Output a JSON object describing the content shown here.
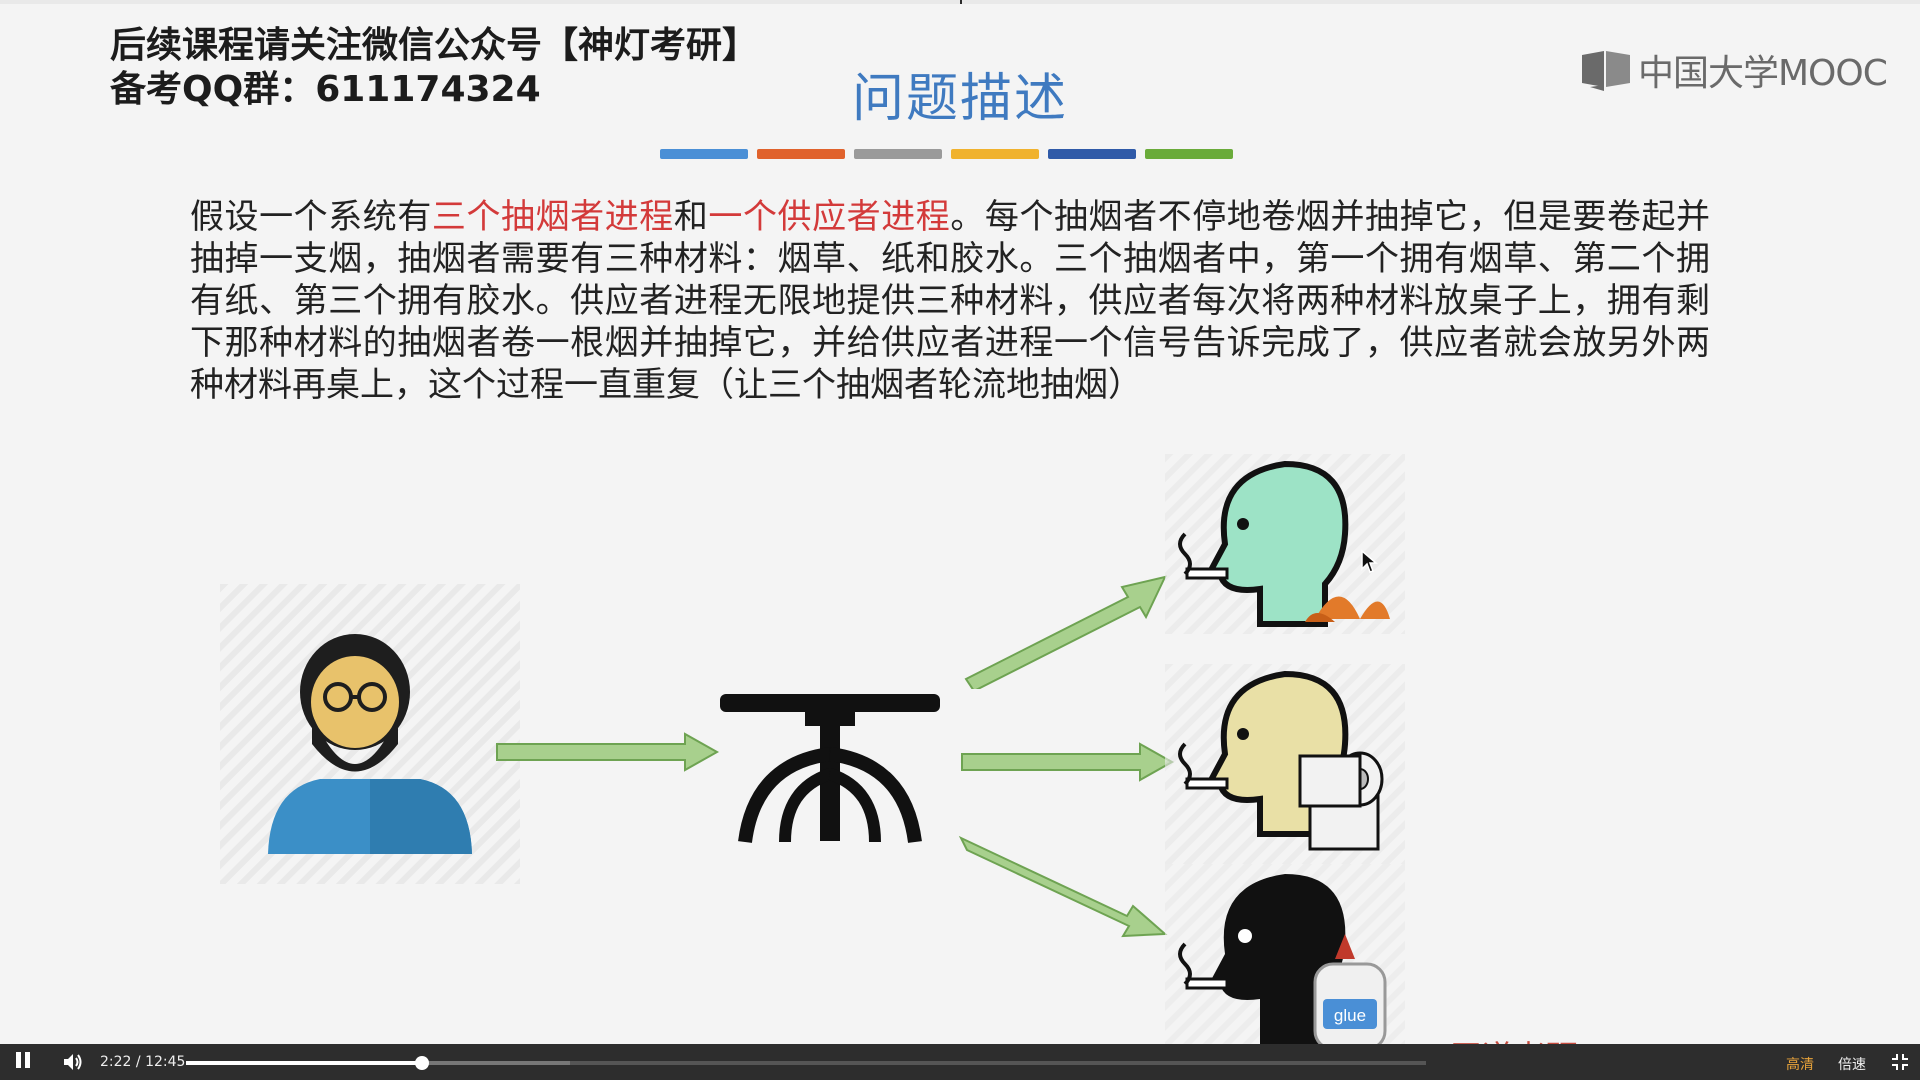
{
  "header": {
    "promo_line1": "后续课程请关注微信公众号【神灯考研】",
    "promo_line2": "备考QQ群：611174324",
    "title": "问题描述",
    "logo_text": "中国大学MOOC",
    "color_bars": [
      "#4a8fd6",
      "#e0622c",
      "#9a9a9a",
      "#f0b22e",
      "#2f5aa8",
      "#6aab3a"
    ]
  },
  "paragraph": {
    "part1": "假设一个系统有",
    "hl1": "三个抽烟者进程",
    "part2": "和",
    "hl2": "一个供应者进程",
    "part3": "。每个抽烟者不停地卷烟并抽掉它，但是要卷起并抽掉一支烟，抽烟者需要有三种材料：烟草、纸和胶水。三个抽烟者中，第一个拥有烟草、第二个拥有纸、第三个拥有胶水。供应者进程无限地提供三种材料，供应者每次将两种材料放桌子上，拥有剩下那种材料的抽烟者卷一根烟并抽掉它，并给供应者进程一个信号告诉完成了，供应者就会放另外两种材料再桌上，这个过程一直重复（让三个抽烟者轮流地抽烟）"
  },
  "diagram": {
    "glue_label": "glue",
    "colors": {
      "arrow": "#a8d08d",
      "arrow_stroke": "#6ea352",
      "smoker1": "#9de3c6",
      "smoker2": "#e9e0a6",
      "smoker3": "#111111",
      "tobacco": "#e27a2a",
      "supplier_shirt": "#3b8fc7"
    }
  },
  "watermark": "王道考研/CSKAOYAN.COM",
  "player": {
    "current_time": "2:22",
    "separator": "/",
    "total_time": "12:45",
    "progress": 0.19,
    "buffered": 0.31,
    "hd_label": "高清",
    "speed_label": "倍速"
  }
}
